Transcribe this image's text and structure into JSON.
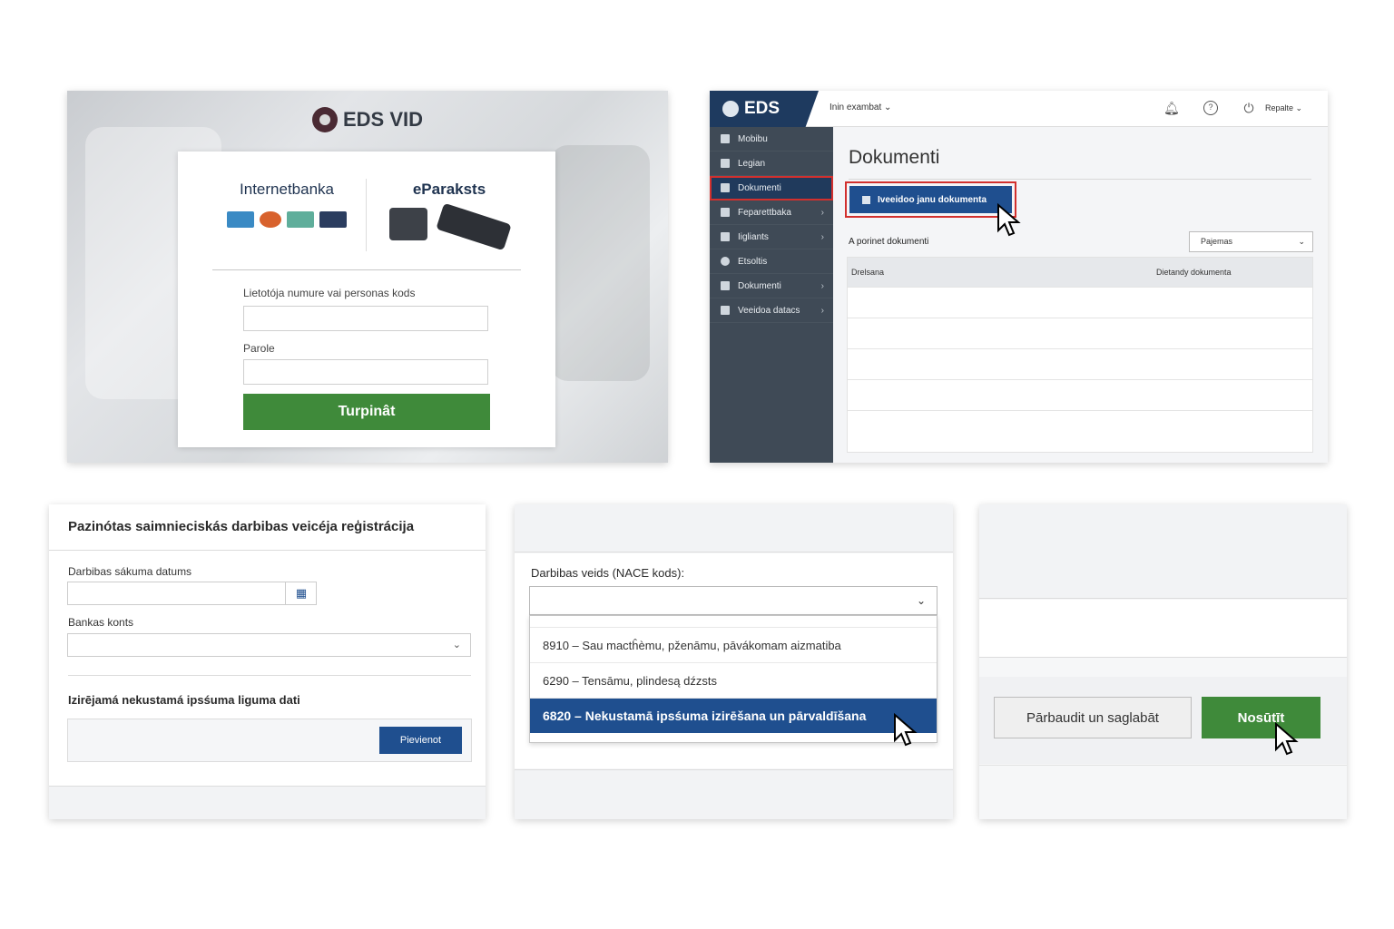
{
  "login": {
    "logo_text": "EDS VID",
    "col_left_title": "Internetbanka",
    "col_right_title": "eParaksts",
    "username_label": "Lietotója numure vai personas kods",
    "password_label": "Parole",
    "continue_button": "Turpinât"
  },
  "dashboard": {
    "brand": "EDS",
    "user_menu": "Inin exambat",
    "repair_menu": "Repalte",
    "sidebar": {
      "items": [
        {
          "label": "Mobibu"
        },
        {
          "label": "Legian"
        },
        {
          "label": "Dokumenti"
        },
        {
          "label": "Feparettbaka"
        },
        {
          "label": "Iigliants"
        },
        {
          "label": "Etsoltis"
        },
        {
          "label": "Dokumenti"
        },
        {
          "label": "Veeidoa datacs"
        }
      ]
    },
    "page_title": "Dokumenti",
    "create_button": "Iveeidoo janu dokumenta",
    "section_label": "A porinet dokumenti",
    "filter_value": "Pajemas",
    "table_headers": [
      "Drelsana",
      "Dietandy dokumenta"
    ]
  },
  "registration": {
    "title": "Pazinótas saimnieciskás darbibas veicéja reģistrácija",
    "start_date_label": "Darbibas sákuma datums",
    "bank_label": "Bankas konts",
    "lease_title": "Izirējamá nekustamá ipsśuma liguma dati",
    "add_button": "Pievienot"
  },
  "nace": {
    "label": "Darbibas veids (NACE kods):",
    "options": [
      "8910 – Sau mactĥèmu, pženāmu, pāvákomam aizmatiba",
      "6290 – Tensāmu, plindesą dźzsts",
      "6820 – Nekustamā ipsśuma izirēšana un pārvaldīšana"
    ]
  },
  "actions": {
    "check_save_button": "Pārbaudit un saglabāt",
    "submit_button": "Nosūtīt"
  },
  "colors": {
    "green": "#3f8a3a",
    "blue": "#1f4f8f",
    "navy": "#1e3a5f",
    "sidebar": "#3f4a56",
    "highlight_red": "#d2302e"
  }
}
